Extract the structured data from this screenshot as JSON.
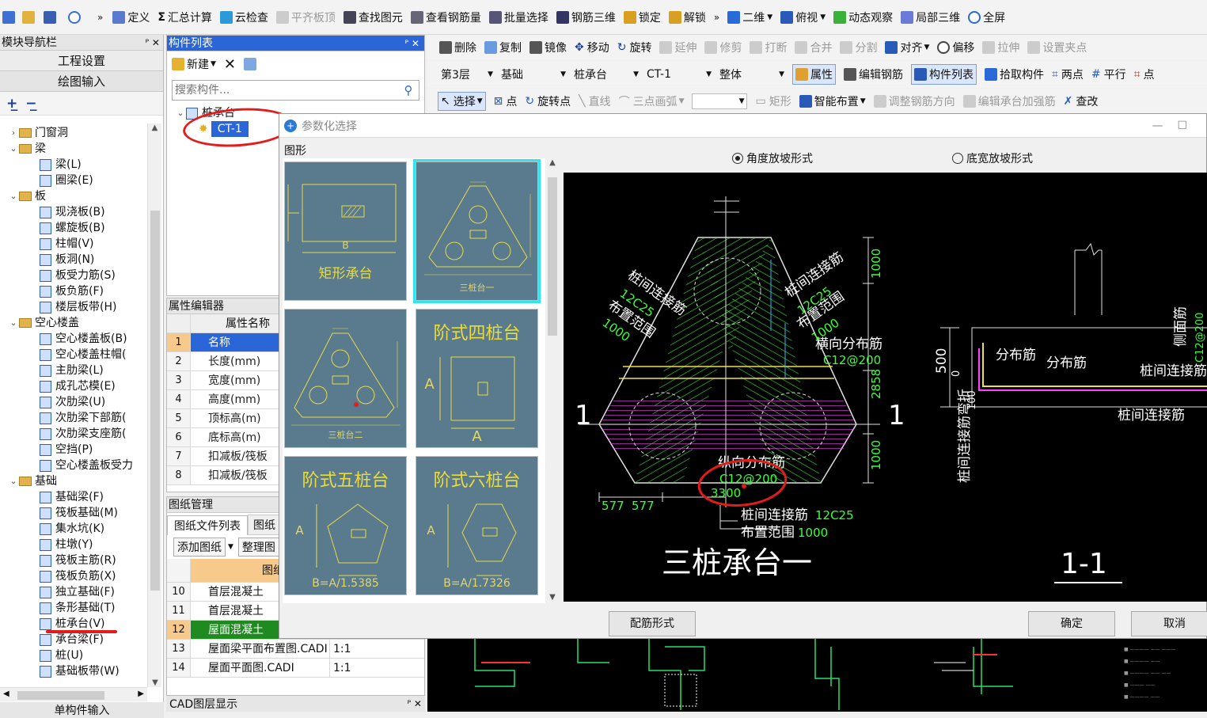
{
  "toolbar1": {
    "items": [
      "定义",
      "汇总计算",
      "云检查",
      "平齐板顶",
      "查找图元",
      "查看钢筋量",
      "批量选择",
      "钢筋三维",
      "锁定",
      "解锁",
      "二维",
      "俯视",
      "动态观察",
      "局部三维",
      "全屏"
    ],
    "more": "»"
  },
  "toolbar2": {
    "items": [
      "删除",
      "复制",
      "镜像",
      "移动",
      "旋转",
      "延伸",
      "修剪",
      "打断",
      "合并",
      "分割",
      "对齐",
      "偏移",
      "拉伸",
      "设置夹点"
    ]
  },
  "toolbar3": {
    "dropdowns": [
      "第3层",
      "基础",
      "桩承台",
      "CT-1",
      "整体"
    ],
    "buttons": [
      "属性",
      "编辑钢筋",
      "构件列表",
      "拾取构件",
      "两点",
      "平行",
      "点"
    ]
  },
  "toolbar4": {
    "buttons": [
      "选择",
      "点",
      "旋转点",
      "直线",
      "三点画弧",
      "",
      "矩形",
      "智能布置",
      "调整钢筋方向",
      "编辑承台加强筋",
      "查改"
    ]
  },
  "nav_panel": {
    "title": "模块导航栏",
    "btn_project": "工程设置",
    "btn_draw": "绘图输入",
    "bottom": "单构件输入",
    "tree": [
      {
        "label": "门窗洞",
        "level": 0,
        "folder": true,
        "expanded": false
      },
      {
        "label": "梁",
        "level": 0,
        "folder": true,
        "expanded": true
      },
      {
        "label": "梁(L)",
        "level": 1
      },
      {
        "label": "圈梁(E)",
        "level": 1
      },
      {
        "label": "板",
        "level": 0,
        "folder": true,
        "expanded": true
      },
      {
        "label": "现浇板(B)",
        "level": 1
      },
      {
        "label": "螺旋板(B)",
        "level": 1
      },
      {
        "label": "柱帽(V)",
        "level": 1
      },
      {
        "label": "板洞(N)",
        "level": 1
      },
      {
        "label": "板受力筋(S)",
        "level": 1
      },
      {
        "label": "板负筋(F)",
        "level": 1
      },
      {
        "label": "楼层板带(H)",
        "level": 1
      },
      {
        "label": "空心楼盖",
        "level": 0,
        "folder": true,
        "expanded": true
      },
      {
        "label": "空心楼盖板(B)",
        "level": 1
      },
      {
        "label": "空心楼盖柱帽(",
        "level": 1
      },
      {
        "label": "主肋梁(L)",
        "level": 1
      },
      {
        "label": "成孔芯模(E)",
        "level": 1
      },
      {
        "label": "次肋梁(U)",
        "level": 1
      },
      {
        "label": "次肋梁下部筋(",
        "level": 1
      },
      {
        "label": "次肋梁支座筋(",
        "level": 1
      },
      {
        "label": "空挡(P)",
        "level": 1
      },
      {
        "label": "空心楼盖板受力",
        "level": 1
      },
      {
        "label": "基础",
        "level": 0,
        "folder": true,
        "expanded": true
      },
      {
        "label": "基础梁(F)",
        "level": 1
      },
      {
        "label": "筏板基础(M)",
        "level": 1
      },
      {
        "label": "集水坑(K)",
        "level": 1
      },
      {
        "label": "柱墩(Y)",
        "level": 1
      },
      {
        "label": "筏板主筋(R)",
        "level": 1
      },
      {
        "label": "筏板负筋(X)",
        "level": 1
      },
      {
        "label": "独立基础(F)",
        "level": 1
      },
      {
        "label": "条形基础(T)",
        "level": 1
      },
      {
        "label": "桩承台(V)",
        "level": 1
      },
      {
        "label": "承台梁(F)",
        "level": 1
      },
      {
        "label": "桩(U)",
        "level": 1
      },
      {
        "label": "基础板带(W)",
        "level": 1
      }
    ]
  },
  "component_list": {
    "title": "构件列表",
    "new_btn": "新建",
    "search_placeholder": "搜索构件...",
    "tree_parent": "桩承台",
    "tree_child": "CT-1"
  },
  "property_editor": {
    "title": "属性编辑器",
    "header": "属性名称",
    "rows": [
      {
        "n": "1",
        "name": "名称"
      },
      {
        "n": "2",
        "name": "长度(mm)"
      },
      {
        "n": "3",
        "name": "宽度(mm)"
      },
      {
        "n": "4",
        "name": "高度(mm)"
      },
      {
        "n": "5",
        "name": "顶标高(m)"
      },
      {
        "n": "6",
        "name": "底标高(m)"
      },
      {
        "n": "7",
        "name": "扣减板/筏板"
      },
      {
        "n": "8",
        "name": "扣减板/筏板"
      }
    ]
  },
  "drawing_mgmt": {
    "title": "图纸管理",
    "tab1": "图纸文件列表",
    "tab2": "图纸",
    "add_btn": "添加图纸",
    "arrange_btn": "整理图",
    "header": "图纸名",
    "rows": [
      {
        "n": "10",
        "name": "首层混凝土",
        "scale": ""
      },
      {
        "n": "11",
        "name": "首层混凝土",
        "scale": ""
      },
      {
        "n": "12",
        "name": "屋面混凝土",
        "scale": "1:1"
      },
      {
        "n": "13",
        "name": "屋面梁平面布置图.CADI",
        "scale": "1:1"
      },
      {
        "n": "14",
        "name": "屋面平面图.CADI",
        "scale": "1:1"
      }
    ]
  },
  "cad_layer": {
    "title": "CAD图层显示"
  },
  "dialog": {
    "title": "参数化选择",
    "group_label": "图形",
    "radio1": "角度放坡形式",
    "radio2": "底宽放坡形式",
    "btn_config": "配筋形式",
    "btn_ok": "确定",
    "btn_cancel": "取消",
    "thumbs": [
      {
        "title": "矩形承台",
        "sub": "B"
      },
      {
        "title": "三桩台一"
      },
      {
        "title": "三桩台二"
      },
      {
        "title": "阶式四桩台",
        "sub1": "A",
        "sub2": "A"
      },
      {
        "title": "阶式五桩台",
        "sub": "B=A/1.5385",
        "side": "A"
      },
      {
        "title": "阶式六桩台",
        "sub": "B=A/1.7326",
        "side": "A"
      }
    ],
    "preview": {
      "title": "三桩承台一",
      "section_title": "1-1",
      "labels": {
        "tie_left": "桩间连接筋",
        "tie_left_spec": "12C25",
        "range_left": "布置范围",
        "range_left_val": "1000",
        "tie_right": "桩间连接筋",
        "tie_right_spec": "12C25",
        "range_right": "布置范围",
        "range_right_val": "1000",
        "transverse": "横向分布筋",
        "transverse_spec": "C12@200",
        "long_dist": "纵向分布筋",
        "long_spec": "C12@200",
        "width": "3300",
        "tie_bottom": "桩间连接筋",
        "tie_bottom_spec": "12C25",
        "range_bottom": "布置范围",
        "range_bottom_val": "1000",
        "dim_top": "1000",
        "dim_mid": "2858",
        "dim_bot": "1000",
        "dim_577a": "577",
        "dim_577b": "577",
        "section_mark": "1",
        "sec_dist1": "分布筋",
        "sec_dist2": "分布筋",
        "sec_tie": "桩间连接筋",
        "sec_tie2": "桩间连接筋",
        "sec_500": "500",
        "sec_0": "0",
        "sec_100": "100",
        "sec_side": "桩间连接筋弯折",
        "sec_right": "侧面筋",
        "sec_right_spec": "C12@200"
      }
    }
  }
}
